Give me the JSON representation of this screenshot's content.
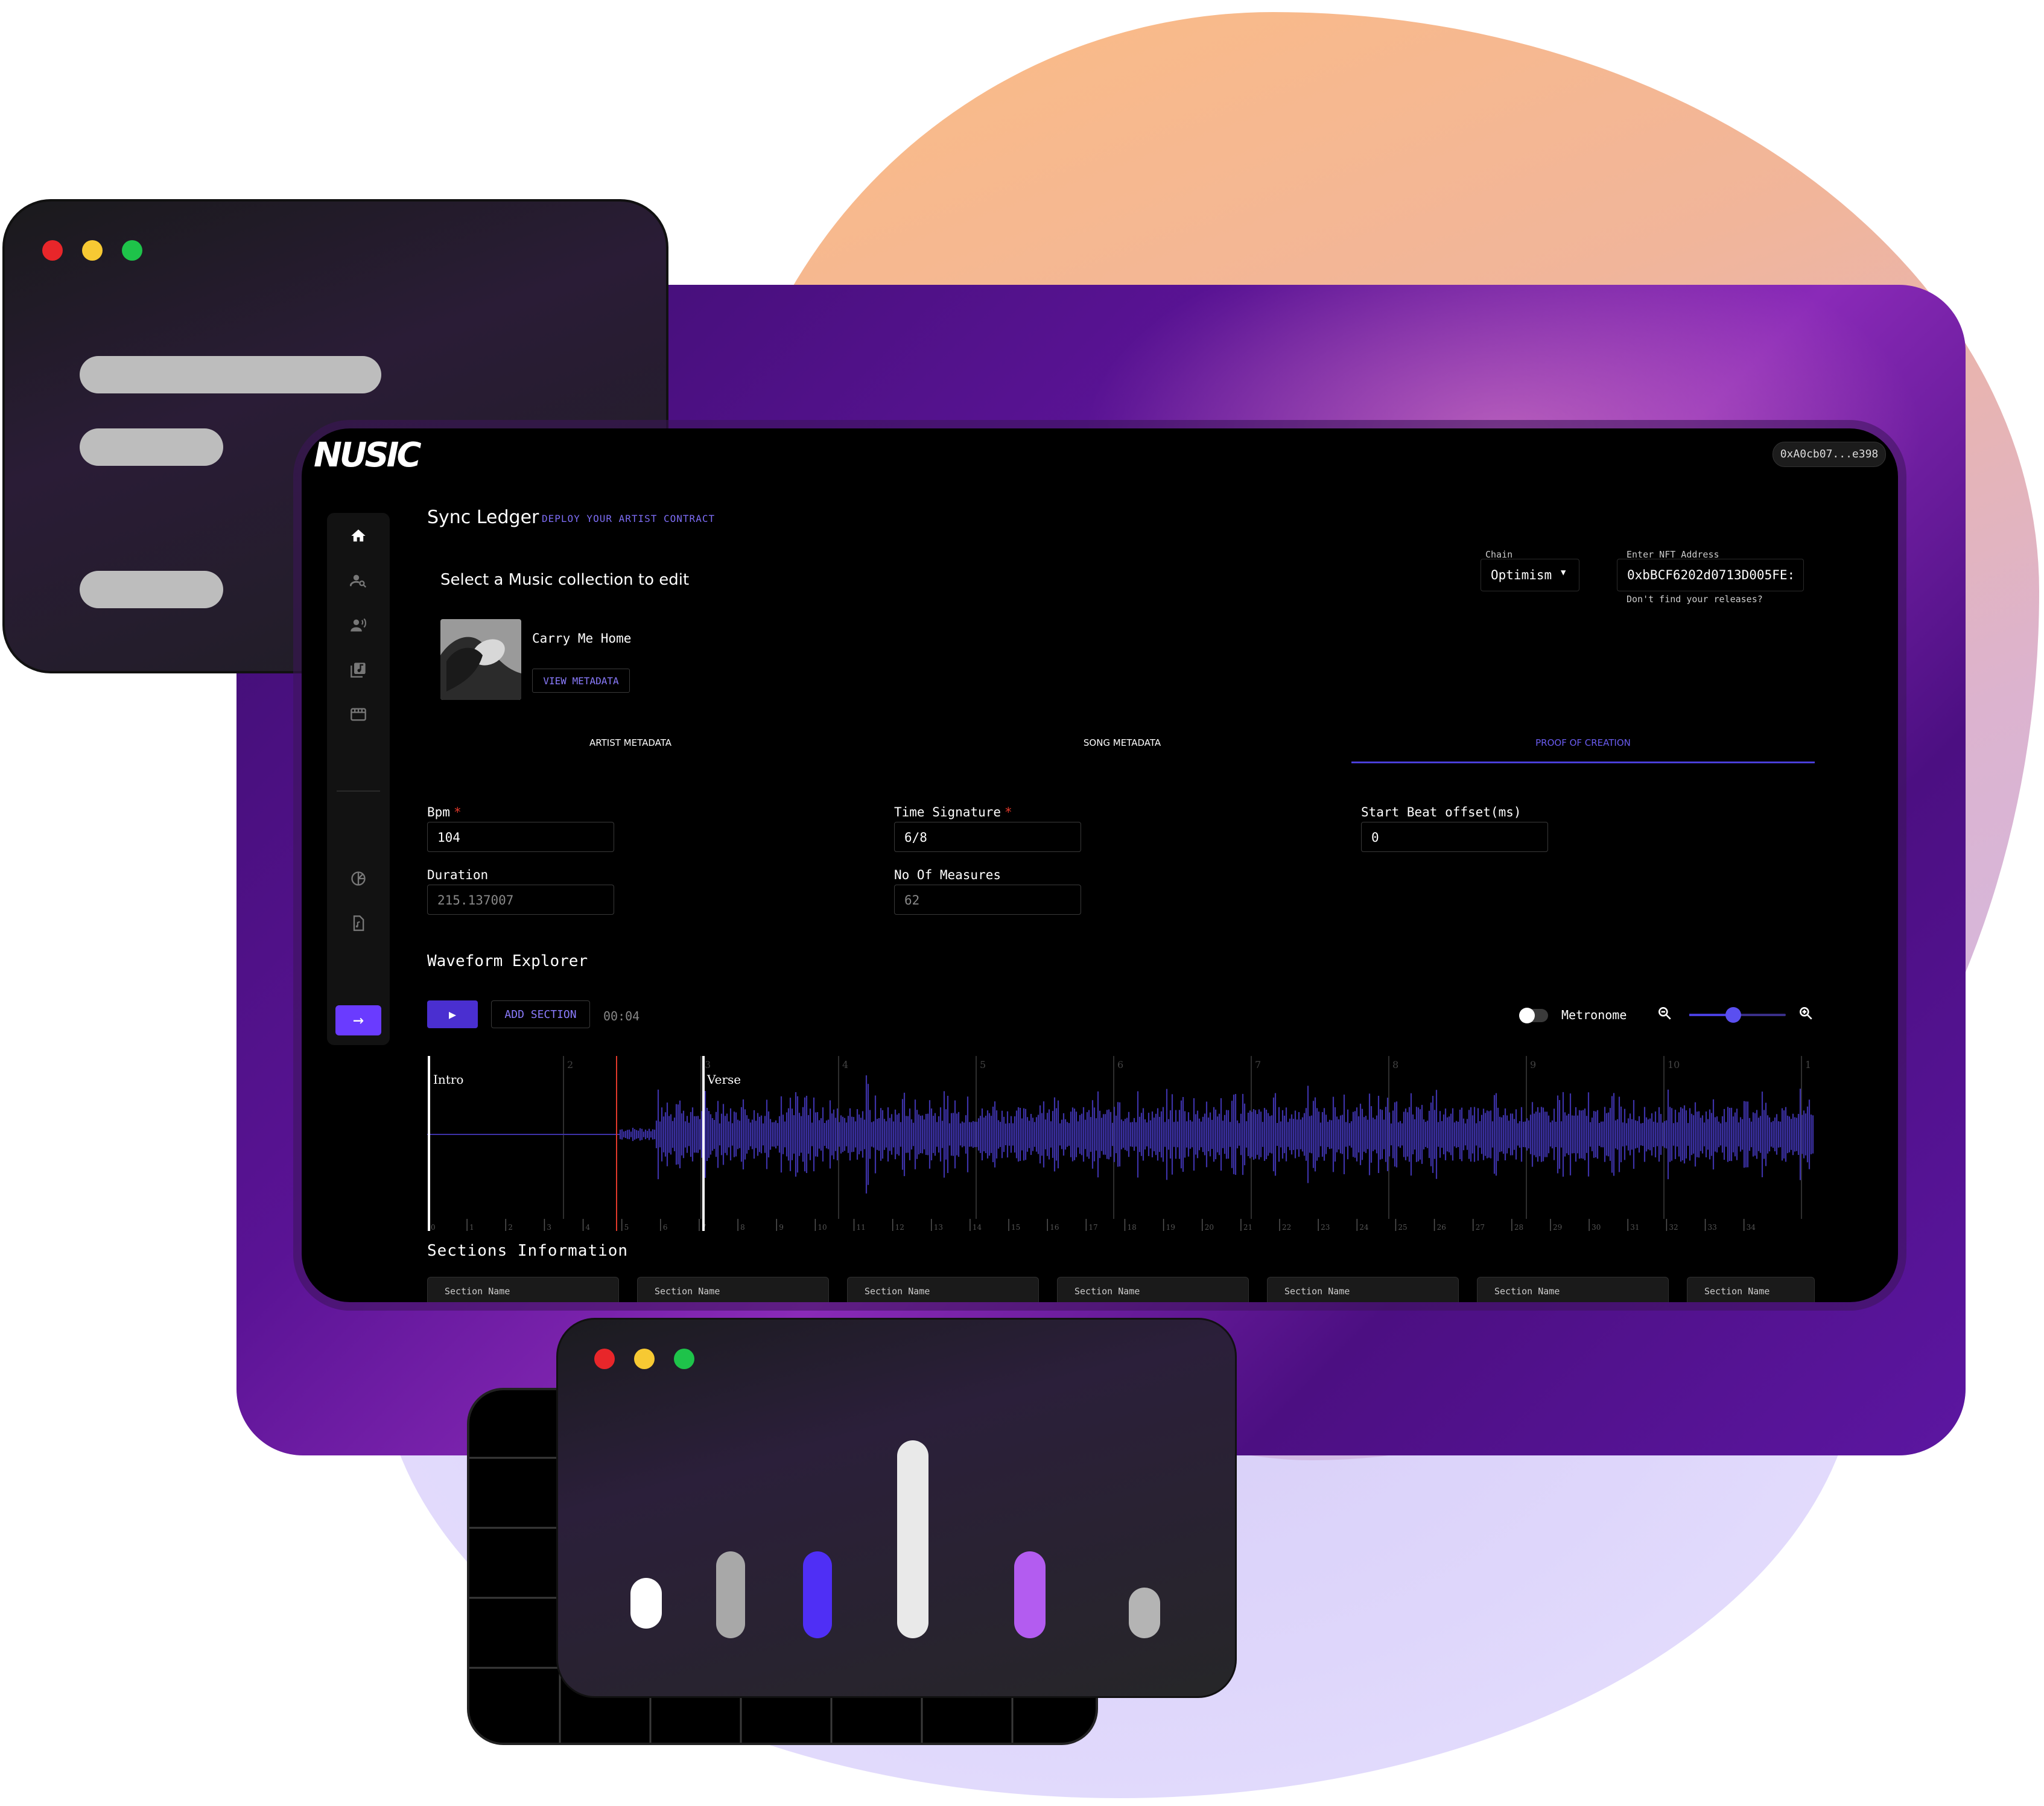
{
  "colors": {
    "accent": "#4a3fd9",
    "accent_light": "#8b7cff",
    "required": "#e2392b",
    "waveform": "#3d32a8",
    "background_app": "#000000"
  },
  "app": {
    "logo": "NUSIC",
    "wallet": "0xA0cb07...e398",
    "page_title": "Sync Ledger",
    "page_subtitle": "DEPLOY YOUR ARTIST CONTRACT",
    "select_title": "Select a Music collection to edit",
    "chain": {
      "label": "Chain",
      "value": "Optimism"
    },
    "nft_address": {
      "label": "Enter NFT Address",
      "value": "0xbBCF6202d0713D005FE:",
      "helper": "Don't find your releases?"
    },
    "track": {
      "name": "Carry Me Home",
      "button": "VIEW METADATA"
    },
    "sidebar_icons": [
      "home-icon",
      "artist-search-icon",
      "artist-voice-icon",
      "library-music-icon",
      "store-icon",
      "chart-icon",
      "document-icon",
      "arrow-right-icon"
    ],
    "tabs": [
      {
        "label": "ARTIST METADATA",
        "active": false
      },
      {
        "label": "SONG METADATA",
        "active": false
      },
      {
        "label": "PROOF OF CREATION",
        "active": true
      }
    ],
    "form": {
      "bpm": {
        "label": "Bpm",
        "value": "104",
        "required": true
      },
      "time_signature": {
        "label": "Time Signature",
        "value": "6/8",
        "required": true
      },
      "start_beat": {
        "label": "Start Beat offset(ms)",
        "value": "0"
      },
      "duration": {
        "label": "Duration",
        "value": "215.137007"
      },
      "measures": {
        "label": "No Of Measures",
        "value": "62"
      }
    },
    "waveform": {
      "title": "Waveform Explorer",
      "add_section": "ADD SECTION",
      "time": "00:04",
      "metronome": "Metronome",
      "zoom_level": 0.45,
      "markers": [
        "Intro",
        "Verse"
      ],
      "top_ticks": [
        "2",
        "3",
        "4",
        "5",
        "6",
        "7",
        "8",
        "9",
        "10",
        "1"
      ],
      "bottom_ticks": [
        "0",
        "1",
        "2",
        "3",
        "4",
        "5",
        "6",
        "7",
        "8",
        "9",
        "10",
        "11",
        "12",
        "13",
        "14",
        "15",
        "16",
        "17",
        "18",
        "19",
        "20",
        "21",
        "22",
        "23",
        "24",
        "25",
        "26",
        "27",
        "28",
        "29",
        "30",
        "31",
        "32",
        "33",
        "34"
      ]
    },
    "sections": {
      "title": "Sections Information",
      "cards": [
        "Section Name",
        "Section Name",
        "Section Name",
        "Section Name",
        "Section Name",
        "Section Name",
        "Section Name"
      ]
    }
  }
}
